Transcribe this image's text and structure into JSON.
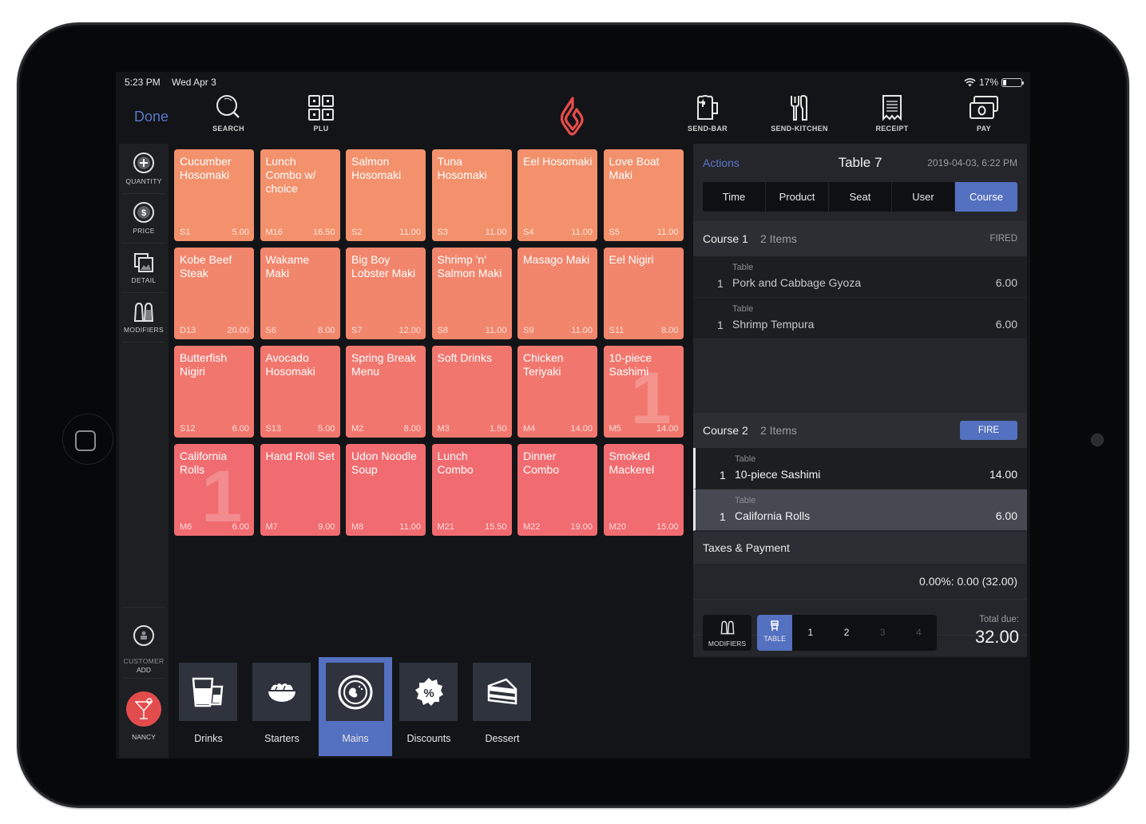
{
  "status_bar": {
    "time": "5:23 PM",
    "date": "Wed Apr 3",
    "battery": "17%",
    "battery_level": 0.17
  },
  "toolbar": {
    "done_label": "Done",
    "left_tools": [
      {
        "label": "SEARCH",
        "icon": "search-icon"
      },
      {
        "label": "PLU",
        "icon": "grid-icon"
      }
    ],
    "right_tools": [
      {
        "label": "SEND-BAR",
        "icon": "beer-mug-icon"
      },
      {
        "label": "SEND-KITCHEN",
        "icon": "fork-knife-icon"
      },
      {
        "label": "RECEIPT",
        "icon": "receipt-icon"
      },
      {
        "label": "PAY",
        "icon": "cash-icon"
      }
    ],
    "logo": "lightspeed-flame-logo"
  },
  "rail": {
    "items": [
      {
        "label": "QUANTITY",
        "icon": "plus-circle-icon"
      },
      {
        "label": "PRICE",
        "icon": "dollar-circle-icon"
      },
      {
        "label": "DETAIL",
        "icon": "detail-images-icon"
      },
      {
        "label": "MODIFIERS",
        "icon": "salt-pepper-icon"
      }
    ],
    "customer": {
      "label_line1": "CUSTOMER",
      "label_line2": "ADD",
      "icon": "customer-icon"
    },
    "user": {
      "name": "NANCY",
      "icon": "cocktail-icon",
      "color": "#e34c4c"
    }
  },
  "products": [
    {
      "name": "Cucumber Hosomaki",
      "code": "S1",
      "price": "5.00",
      "color": "#f2916c"
    },
    {
      "name": "Lunch Combo w/ choice",
      "code": "M16",
      "price": "16.50",
      "color": "#f2916c"
    },
    {
      "name": "Salmon Hosomaki",
      "code": "S2",
      "price": "11.00",
      "color": "#f2916c"
    },
    {
      "name": "Tuna Hosomaki",
      "code": "S3",
      "price": "11.00",
      "color": "#f2916c"
    },
    {
      "name": "Eel Hosomaki",
      "code": "S4",
      "price": "11.00",
      "color": "#f2916c"
    },
    {
      "name": "Love Boat Maki",
      "code": "S5",
      "price": "11.00",
      "color": "#f2916c"
    },
    {
      "name": "Kobe Beef Steak",
      "code": "D13",
      "price": "20.00",
      "color": "#f1866c"
    },
    {
      "name": "Wakame Maki",
      "code": "S6",
      "price": "8.00",
      "color": "#f1866c"
    },
    {
      "name": "Big Boy Lobster Maki",
      "code": "S7",
      "price": "12.00",
      "color": "#f1866c"
    },
    {
      "name": "Shrimp 'n' Salmon Maki",
      "code": "S8",
      "price": "11.00",
      "color": "#f1866c"
    },
    {
      "name": "Masago Maki",
      "code": "S9",
      "price": "11.00",
      "color": "#f1866c"
    },
    {
      "name": "Eel Nigiri",
      "code": "S11",
      "price": "8.00",
      "color": "#f1866c"
    },
    {
      "name": "Butterfish Nigiri",
      "code": "S12",
      "price": "6.00",
      "color": "#f1776e"
    },
    {
      "name": "Avocado Hosomaki",
      "code": "S13",
      "price": "5.00",
      "color": "#f1776e"
    },
    {
      "name": "Spring Break Menu",
      "code": "M2",
      "price": "8.00",
      "color": "#f1776e"
    },
    {
      "name": "Soft Drinks",
      "code": "M3",
      "price": "1.50",
      "color": "#f1776e"
    },
    {
      "name": "Chicken Teriyaki",
      "code": "M4",
      "price": "14.00",
      "color": "#f1776e"
    },
    {
      "name": "10-piece Sashimi",
      "code": "M5",
      "price": "14.00",
      "color": "#f1776e",
      "qty": "1"
    },
    {
      "name": "California Rolls",
      "code": "M6",
      "price": "6.00",
      "color": "#f06c70",
      "qty": "1"
    },
    {
      "name": "Hand Roll Set",
      "code": "M7",
      "price": "9.00",
      "color": "#f06c70"
    },
    {
      "name": "Udon Noodle Soup",
      "code": "M8",
      "price": "11.00",
      "color": "#f06c70"
    },
    {
      "name": "Lunch Combo",
      "code": "M21",
      "price": "15.50",
      "color": "#f06c70"
    },
    {
      "name": "Dinner Combo",
      "code": "M22",
      "price": "19.00",
      "color": "#f06c70"
    },
    {
      "name": "Smoked Mackerel",
      "code": "M20",
      "price": "15.00",
      "color": "#f06c70"
    }
  ],
  "categories": [
    {
      "label": "Drinks",
      "icon": "drinks-glass-icon",
      "active": false
    },
    {
      "label": "Starters",
      "icon": "salad-bowl-icon",
      "active": false
    },
    {
      "label": "Mains",
      "icon": "plate-icon",
      "active": true
    },
    {
      "label": "Discounts",
      "icon": "percent-badge-icon",
      "active": false
    },
    {
      "label": "Dessert",
      "icon": "cake-slice-icon",
      "active": false
    }
  ],
  "order": {
    "actions_label": "Actions",
    "title": "Table 7",
    "timestamp": "2019-04-03, 6:22 PM",
    "sort_tabs": [
      {
        "label": "Time",
        "active": false
      },
      {
        "label": "Product",
        "active": false
      },
      {
        "label": "Seat",
        "active": false
      },
      {
        "label": "User",
        "active": false
      },
      {
        "label": "Course",
        "active": true
      }
    ],
    "courses": [
      {
        "name": "Course 1",
        "count": "2 Items",
        "status": "FIRED",
        "items": [
          {
            "seat": "Table",
            "qty": "1",
            "name": "Pork and Cabbage Gyoza",
            "price": "6.00"
          },
          {
            "seat": "Table",
            "qty": "1",
            "name": "Shrimp Tempura",
            "price": "6.00"
          }
        ]
      },
      {
        "name": "Course 2",
        "count": "2 Items",
        "action": "FIRE",
        "items": [
          {
            "seat": "Table",
            "qty": "1",
            "name": "10-piece Sashimi",
            "price": "14.00"
          },
          {
            "seat": "Table",
            "qty": "1",
            "name": "California Rolls",
            "price": "6.00",
            "selected": true
          }
        ]
      }
    ],
    "taxes_label": "Taxes & Payment",
    "tax_line": "0.00%: 0.00 (32.00)",
    "modifiers_label": "MODIFIERS",
    "seat_options": [
      {
        "label": "TABLE",
        "active": true,
        "icon": "chair-icon"
      },
      {
        "label": "1"
      },
      {
        "label": "2"
      },
      {
        "label": "3",
        "dim": true
      },
      {
        "label": "4",
        "dim": true
      }
    ],
    "total_label": "Total due:",
    "total_value": "32.00"
  },
  "theme": {
    "accent": "#5470c0",
    "brand_red": "#e34c4c"
  }
}
